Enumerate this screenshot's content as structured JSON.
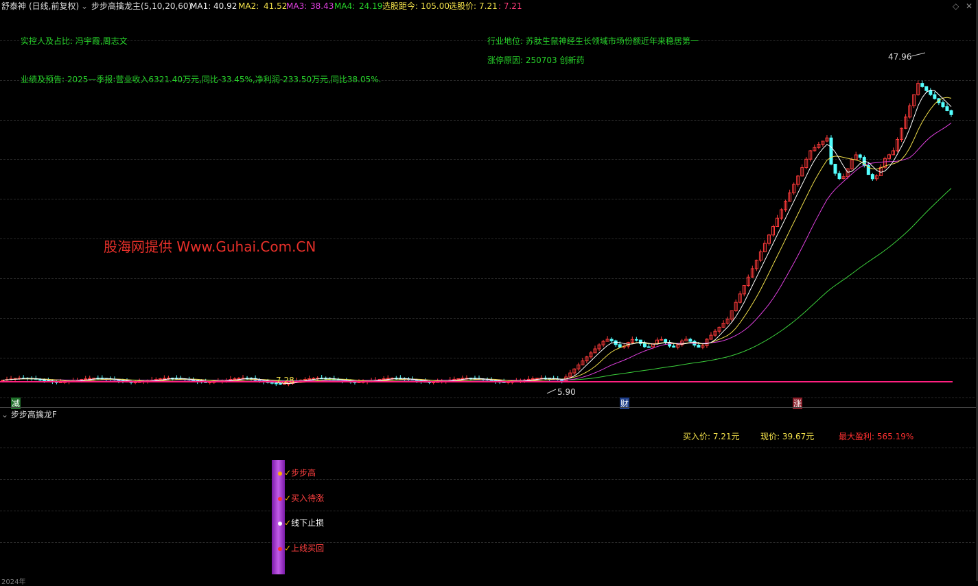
{
  "header": {
    "stock": "舒泰神",
    "mode": "(日线,前复权)",
    "indicator": "步步高擒龙主(5,10,20,60)",
    "ma1_label": "MA1:",
    "ma1_value": "40.92",
    "ma2_label": "MA2:",
    "ma2_value": "41.52",
    "ma3_label": "MA3:",
    "ma3_value": "38.43",
    "ma4_label": "MA4:",
    "ma4_value": "24.19",
    "distance_label": "选股距今:",
    "distance_value": "105.00",
    "select_price_label": "选股价:",
    "select_price_value": "7.21",
    "select_price_extra": ": 7.21",
    "diamond": "◇",
    "close": "✕"
  },
  "info": {
    "controller": "实控人及占比: 冯宇霞,周志文",
    "industry": "行业地位: 苏肽生鼠神经生长领域市场份额近年来稳居第一",
    "limit_reason": "涨停原因: 250703 创新药",
    "forecast": "业绩及预告: 2025一季报:营业收入6321.40万元,同比-33.45%,净利润-233.50万元,同比38.05%."
  },
  "watermark": "股海网提供 Www.Guhai.Com.CN",
  "markers": {
    "high": "47.96",
    "low": "5.90",
    "buy_line": "7.28",
    "event_jian": "减",
    "event_cai": "财",
    "event_zhang": "涨"
  },
  "sub": {
    "title": "步步高擒龙F",
    "buy_price": "买入价: 7.21元",
    "current_price": "现价: 39.67元",
    "max_profit": "最大盈利: 565.19%",
    "signals": [
      "步步高",
      "买入待涨",
      "线下止损",
      "上线买回"
    ]
  },
  "xaxis": {
    "year": "2024年"
  },
  "colors": {
    "up": "#ff3b3b",
    "down": "#54ffff",
    "ma1": "#ffffff",
    "ma2": "#f2e04a",
    "ma3": "#e040e0",
    "ma4": "#3cd23c",
    "buyline": "#ff2080"
  },
  "chart_data": {
    "type": "candlestick",
    "ma_periods": [
      5,
      10,
      20,
      60
    ],
    "ylim": [
      5.0,
      50.0
    ],
    "high": 47.96,
    "low": 5.9,
    "ma_last": {
      "MA1": 40.92,
      "MA2": 41.52,
      "MA3": 38.43,
      "MA4": 24.19
    }
  }
}
